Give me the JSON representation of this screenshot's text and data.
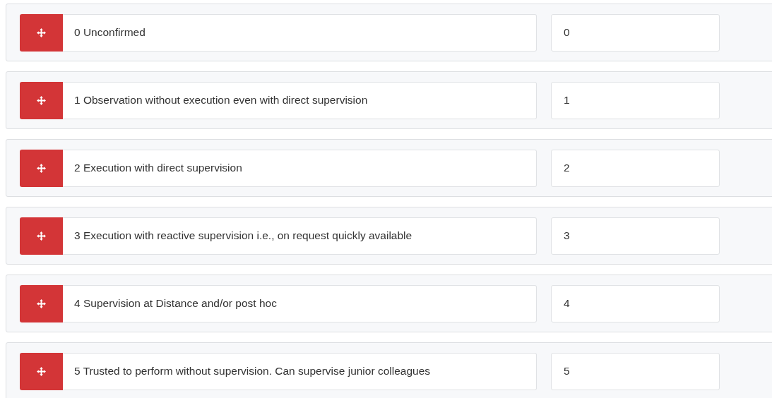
{
  "rows": [
    {
      "label": "0 Unconfirmed",
      "value": "0"
    },
    {
      "label": "1 Observation without execution even with direct supervision",
      "value": "1"
    },
    {
      "label": "2 Execution with direct supervision",
      "value": "2"
    },
    {
      "label": "3 Execution with reactive supervision i.e., on request quickly available",
      "value": "3"
    },
    {
      "label": "4 Supervision at Distance and/or post hoc",
      "value": "4"
    },
    {
      "label": "5 Trusted to perform without supervision. Can supervise junior colleagues",
      "value": "5"
    }
  ]
}
